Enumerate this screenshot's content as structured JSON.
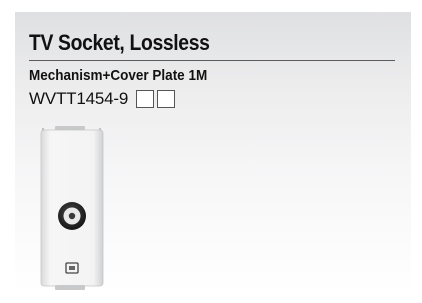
{
  "product": {
    "title": "TV Socket, Lossless",
    "subtitle": "Mechanism+Cover Plate 1M",
    "code": "WVTT1454-9",
    "color_options": [
      {
        "name": "color-option-1",
        "color": "#ffffff"
      },
      {
        "name": "color-option-2",
        "color": "#ffffff"
      }
    ],
    "icon_label": "TV"
  },
  "colors": {
    "title_rule": "#5c5c5c",
    "plate": "#f2f3f3",
    "connector_ring": "#2a2a2a"
  }
}
